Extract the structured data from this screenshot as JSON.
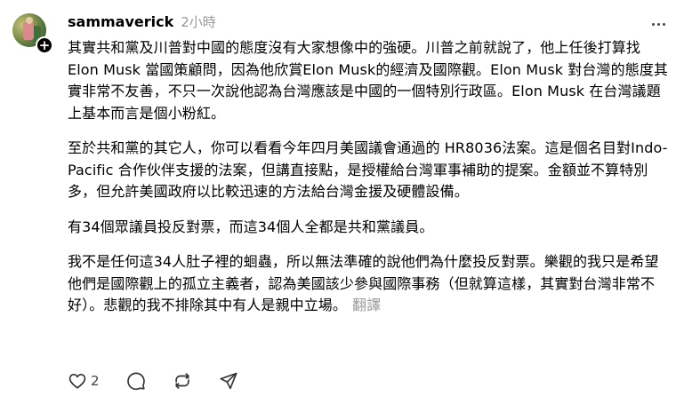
{
  "post": {
    "username": "sammaverick",
    "timestamp": "2小時",
    "paragraphs": [
      "其實共和黨及川普對中國的態度沒有大家想像中的強硬。川普之前就說了，他上任後打算找Elon Musk 當國策顧問，因為他欣賞Elon Musk的經濟及國際觀。Elon Musk 對台灣的態度其實非常不友善，不只一次說他認為台灣應該是中國的一個特別行政區。Elon Musk 在台灣議題上基本而言是個小粉紅。",
      "至於共和黨的其它人，你可以看看今年四月美國議會通過的 HR8036法案。這是個名目對Indo-Pacific 合作伙伴支援的法案，但講直接點，是授權給台灣軍事補助的提案。金額並不算特別多，但允許美國政府以比較迅速的方法給台灣金援及硬體設備。",
      "有34個眾議員投反對票，而這34個人全都是共和黨議員。",
      "我不是任何這34人肚子裡的蛔蟲，所以無法準確的說他們為什麼投反對票。樂觀的我只是希望他們是國際觀上的孤立主義者，認為美國該少參與國際事務（但就算這樣，其實對台灣非常不好）。悲觀的我不排除其中有人是親中立場。"
    ],
    "translate_label": "翻譯",
    "like_count": "2"
  },
  "icons": {
    "like": "heart-icon",
    "reply": "comment-icon",
    "repost": "repost-icon",
    "share": "share-icon",
    "more": "more-icon",
    "follow": "plus-icon"
  }
}
